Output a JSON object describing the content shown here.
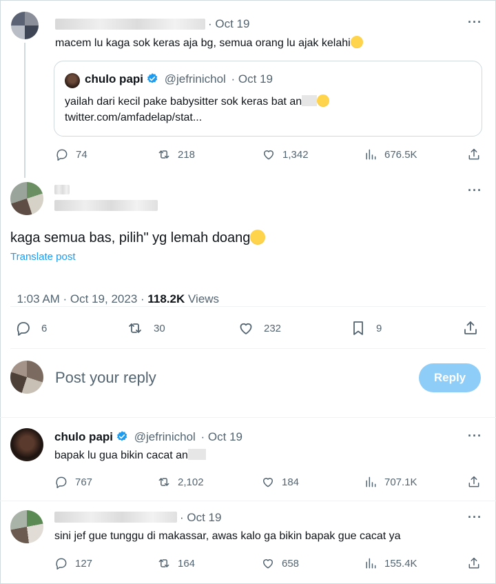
{
  "tweet1": {
    "date": "· Oct 19",
    "text": "macem lu kaga sok keras aja bg, semua orang lu ajak kelahi",
    "quote": {
      "name": "chulo papi",
      "handle": "@jefrinichol",
      "date": "· Oct 19",
      "text": "yailah dari kecil pake babysitter sok keras bat an",
      "link": "twitter.com/amfadelap/stat..."
    },
    "stats": {
      "replies": "74",
      "reposts": "218",
      "likes": "1,342",
      "views": "676.5K"
    }
  },
  "main_tweet": {
    "text": "kaga semua bas, pilih\" yg lemah doang",
    "translate": "Translate post",
    "timestamp": "1:03 AM · Oct 19, 2023 · ",
    "views_count": "118.2K",
    "views_label": " Views",
    "stats": {
      "replies": "6",
      "reposts": "30",
      "likes": "232",
      "bookmarks": "9"
    }
  },
  "reply_box": {
    "placeholder": "Post your reply",
    "button": "Reply"
  },
  "reply1": {
    "name": "chulo papi",
    "handle": "@jefrinichol",
    "date": "· Oct 19",
    "text": "bapak lu gua bikin cacat an",
    "stats": {
      "replies": "767",
      "reposts": "2,102",
      "likes": "184",
      "views": "707.1K"
    }
  },
  "reply2": {
    "date": "· Oct 19",
    "text": "sini jef gue tunggu di makassar, awas kalo ga bikin bapak gue cacat ya",
    "stats": {
      "replies": "127",
      "reposts": "164",
      "likes": "658",
      "views": "155.4K"
    }
  }
}
